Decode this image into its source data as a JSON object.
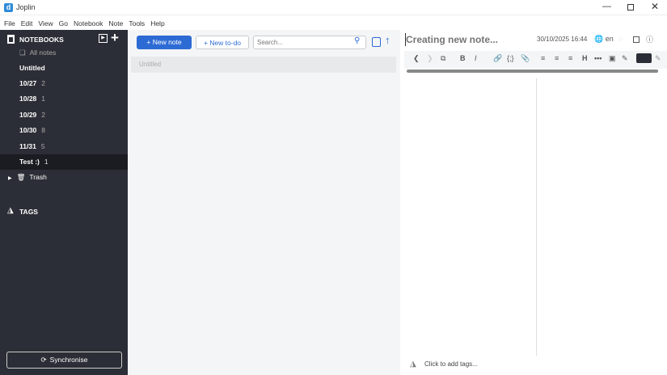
{
  "window": {
    "title": "Joplin",
    "app_icon": "d"
  },
  "menu": [
    "File",
    "Edit",
    "View",
    "Go",
    "Notebook",
    "Note",
    "Tools",
    "Help"
  ],
  "sidebar": {
    "notebooks_header": "NOTEBOOKS",
    "all_notes": "All notes",
    "notebooks": [
      {
        "label": "Untitled",
        "count": ""
      },
      {
        "label": "10/27",
        "count": "2"
      },
      {
        "label": "10/28",
        "count": "1"
      },
      {
        "label": "10/29",
        "count": "2"
      },
      {
        "label": "10/30",
        "count": "8"
      },
      {
        "label": "11/31",
        "count": "5"
      },
      {
        "label": "Test :)",
        "count": "1",
        "selected": true
      }
    ],
    "trash": "Trash",
    "tags_header": "TAGS",
    "sync_label": "Synchronise"
  },
  "notelist": {
    "new_note": "+ New note",
    "new_todo": "+ New to-do",
    "search_placeholder": "Search...",
    "notes": [
      {
        "title": "Untitled"
      }
    ]
  },
  "editor": {
    "title_placeholder": "Creating new note...",
    "datetime": "30/10/2025 16:44",
    "language": "en",
    "tags_placeholder": "Click to add tags..."
  },
  "colors": {
    "accent": "#2d6bd4",
    "sidebar_bg": "#2b2e36"
  }
}
